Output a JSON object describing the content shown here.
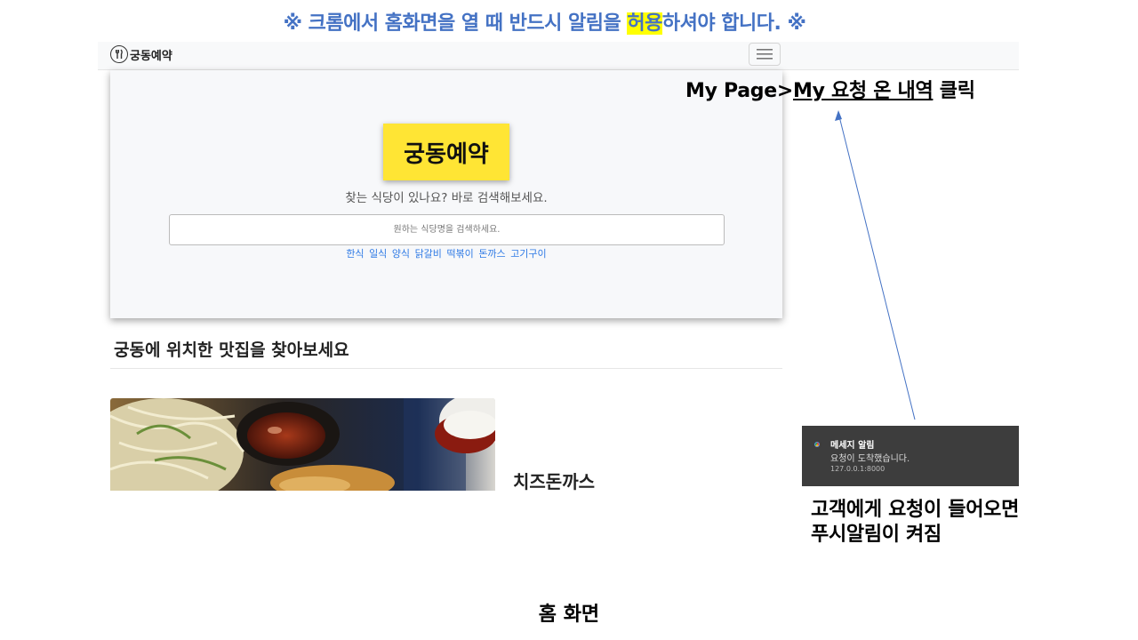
{
  "notice": {
    "prefix": "※ 크롬에서 홈화면을 열 때 반드시 알림을 ",
    "highlight": "허용",
    "suffix": "하셔야 합니다. ※"
  },
  "navbar": {
    "brand": "궁동예약",
    "logo_icon": "fork-knife-icon",
    "menu_icon": "hamburger-icon"
  },
  "hero": {
    "logo_text": "궁동예약",
    "subtitle": "찾는 식당이 있나요? 바로 검색해보세요.",
    "search_placeholder": "원하는 식당명을 검색하세요.",
    "search_value": "",
    "quick_links": [
      "한식",
      "일식",
      "양식",
      "닭갈비",
      "떡볶이",
      "돈까스",
      "고기구이"
    ]
  },
  "section": {
    "title": "궁동에 위치한 맛집을 찾아보세요"
  },
  "restaurant": {
    "name": "치즈돈까스"
  },
  "annotations": {
    "mypage_prefix": "My Page>",
    "mypage_link": "My 요청 온 내역",
    "mypage_suffix": " 클릭",
    "push_line1": "고객에게 요청이 들어오면",
    "push_line2": "푸시알림이 켜짐",
    "caption": "홈 화면"
  },
  "push_notification": {
    "title": "메세지 알림",
    "body": "요청이 도착했습니다.",
    "origin": "127.0.0.1:8000",
    "icon": "chrome-icon"
  },
  "colors": {
    "notice_blue": "#4472c4",
    "highlight_yellow": "#ffff00",
    "logo_yellow": "#ffe534",
    "link_blue": "#2f7ae5",
    "push_bg": "#3d3d3d"
  }
}
